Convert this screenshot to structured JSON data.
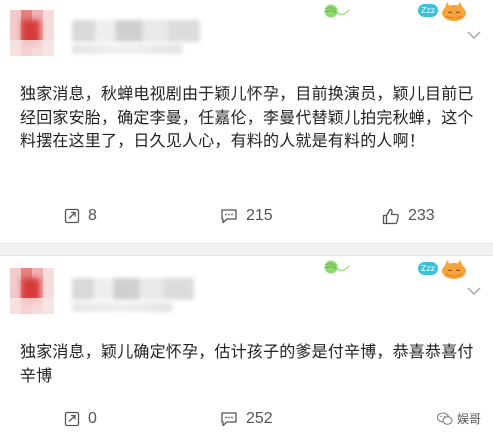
{
  "posts": [
    {
      "text": "独家消息，秋蝉电视剧由于颖儿怀孕，目前换演员，颖儿目前已经回家安胎，确定李曼，任嘉伦，李曼代替颖儿拍完秋蝉，这个料摆在这里了，日久见人心，有料的人就是有料的人啊！",
      "repost_count": "8",
      "comment_count": "215",
      "like_count": "233"
    },
    {
      "text": "独家消息，颖儿确定怀孕，估计孩子的爹是付辛博，恭喜恭喜付辛博",
      "repost_count": "0",
      "comment_count": "252",
      "like_count": ""
    }
  ],
  "badge": {
    "label": "Zzz"
  },
  "watermark": {
    "label": "娱哥"
  },
  "icons": {
    "repost": "repost-icon",
    "comment": "comment-icon",
    "like": "thumbs-up-icon",
    "more": "chevron-down-icon",
    "wechat": "wechat-icon"
  },
  "colors": {
    "text": "#222222",
    "action": "#555555",
    "divider": "#f2f2f2",
    "badge": "#3cc1d8",
    "chevron": "#b0b0b0"
  }
}
